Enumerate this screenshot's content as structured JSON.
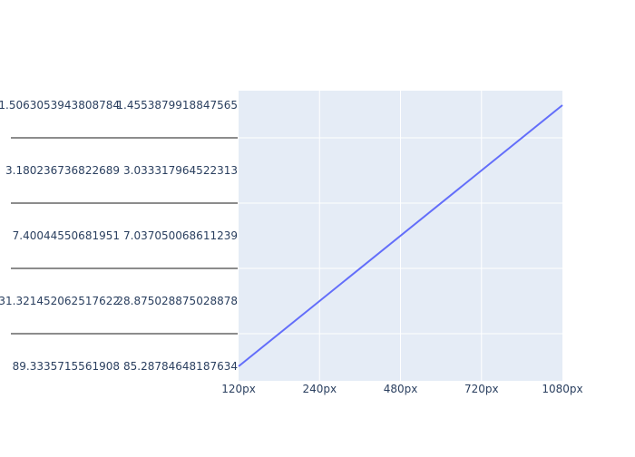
{
  "chart_data": {
    "type": "line",
    "x_tick_labels": [
      "120px",
      "240px",
      "480px",
      "720px",
      "1080px"
    ],
    "y_tick_labels_left": [
      "1.5063053943808784",
      "3.180236736822689",
      "7.40044550681951",
      "31.321452062517622",
      "89.3335715561908"
    ],
    "y_tick_labels_right": [
      "1.4553879918847565",
      "3.033317964522313",
      "7.037050068611239",
      "28.875028875028878",
      "85.28784648187634"
    ],
    "series": [
      {
        "x": [
          "120px",
          "1080px"
        ],
        "y_band": [
          4.5,
          -0.5
        ]
      }
    ],
    "xlim": [
      "120px",
      "1080px"
    ],
    "grid": true,
    "line_color": "#636efa",
    "plot_background": "#e5ecf6",
    "gridline_color": "#ffffff",
    "divider_color": "#8c8c8c",
    "tick_label_color": "#2a3f5f"
  }
}
